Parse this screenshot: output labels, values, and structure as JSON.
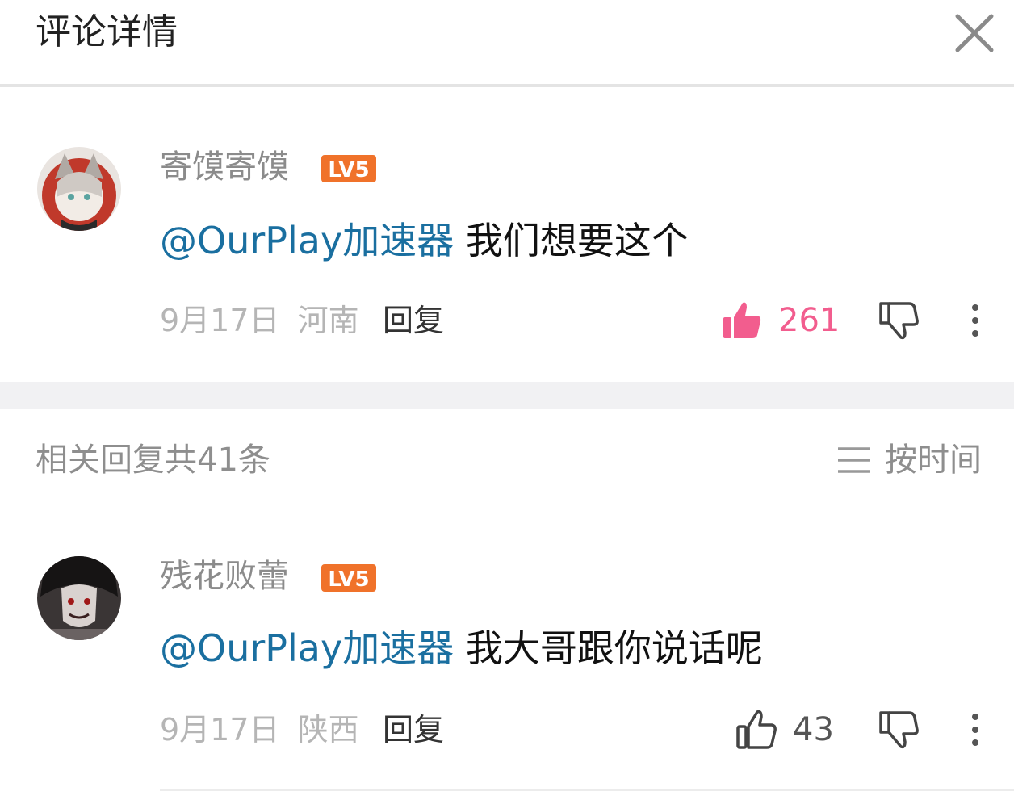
{
  "header": {
    "title": "评论详情"
  },
  "comments": [
    {
      "username": "寄馍寄馍",
      "level": "LV5",
      "mention": "@OurPlay加速器",
      "text": "我们想要这个",
      "date": "9月17日",
      "location": "河南",
      "reply_label": "回复",
      "likes": "261",
      "liked": true
    }
  ],
  "replies_section": {
    "count_label": "相关回复共41条",
    "sort_label": "按时间"
  },
  "replies": [
    {
      "username": "残花败蕾",
      "level": "LV5",
      "mention": "@OurPlay加速器",
      "text": "我大哥跟你说话呢",
      "date": "9月17日",
      "location": "陕西",
      "reply_label": "回复",
      "likes": "43",
      "liked": false
    }
  ],
  "colors": {
    "accent_pink": "#f25d8e",
    "mention_blue": "#1a6fa0",
    "level_orange": "#f0722a"
  }
}
